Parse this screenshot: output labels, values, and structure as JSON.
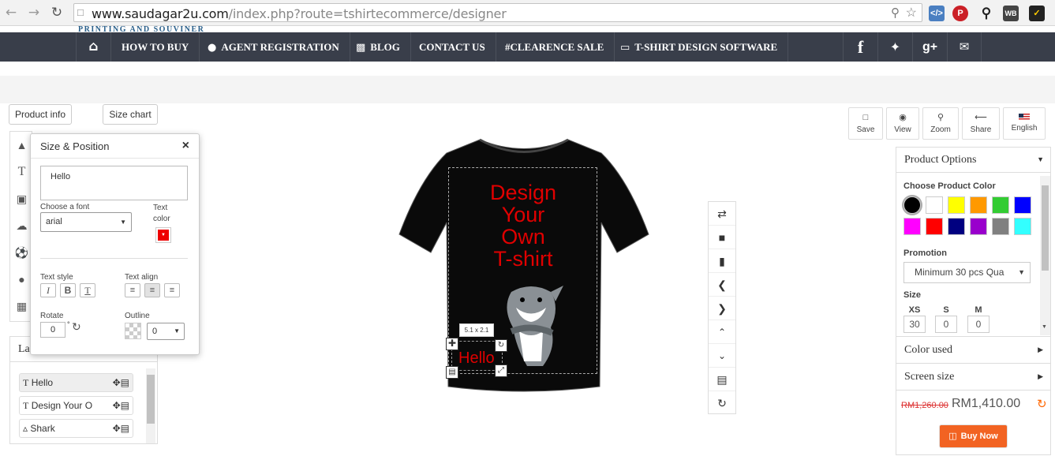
{
  "browser": {
    "url_host": "www.saudagar2u.com",
    "url_path": "/index.php?route=tshirtecommerce/designer"
  },
  "brand": {
    "tagline": "PRINTING AND SOUVINER"
  },
  "nav": {
    "items": [
      "HOW TO BUY",
      "AGENT REGISTRATION",
      "BLOG",
      "CONTACT US",
      "#CLEARENCE SALE",
      "T-SHIRT DESIGN SOFTWARE"
    ],
    "social": [
      "f",
      "twitter",
      "g+",
      "mail"
    ]
  },
  "top_buttons": {
    "product_info": "Product info",
    "size_chart": "Size chart"
  },
  "toolbar_right": [
    "Save",
    "View",
    "Zoom",
    "Share",
    "English"
  ],
  "size_position": {
    "title": "Size & Position",
    "close": "×",
    "text_value": "Hello",
    "font_label": "Choose a font",
    "font_value": "arial",
    "text_color_label": "Text color",
    "text_color": "#ee0000",
    "text_style_label": "Text style",
    "text_align_label": "Text align",
    "rotate_label": "Rotate",
    "rotate_value": "0",
    "rotate_unit": "°",
    "outline_label": "Outline",
    "outline_value": "0"
  },
  "layers": {
    "tab": "La",
    "items": [
      {
        "label": "Hello",
        "icon": "text-icon"
      },
      {
        "label": "Design Your O",
        "icon": "text-icon"
      },
      {
        "label": "Shark",
        "icon": "image-icon"
      }
    ]
  },
  "canvas": {
    "design_text": [
      "Design",
      "Your",
      "Own",
      "T-shirt"
    ],
    "design_text_color": "#e00000",
    "hello_text": "Hello",
    "size_badge": "5.1 x 2.1"
  },
  "options": {
    "title": "Product Options",
    "color_label": "Choose Product Color",
    "colors": [
      "#000000",
      "#ffffff",
      "#ffff00",
      "#ff9900",
      "#33cc33",
      "#0000ff",
      "#ff00ff",
      "#ff0000",
      "#000080",
      "#9900cc",
      "#808080",
      "#33ffff"
    ],
    "promotion_label": "Promotion",
    "promotion_value": "Minimum 30 pcs Qua",
    "size_label": "Size",
    "sizes": [
      {
        "name": "XS",
        "qty": "30"
      },
      {
        "name": "S",
        "qty": "0"
      },
      {
        "name": "M",
        "qty": "0"
      }
    ],
    "color_used": "Color used",
    "screen_size": "Screen size",
    "old_price": "RM1,260.00",
    "price": "RM1,410.00",
    "buy_now": "Buy Now"
  }
}
